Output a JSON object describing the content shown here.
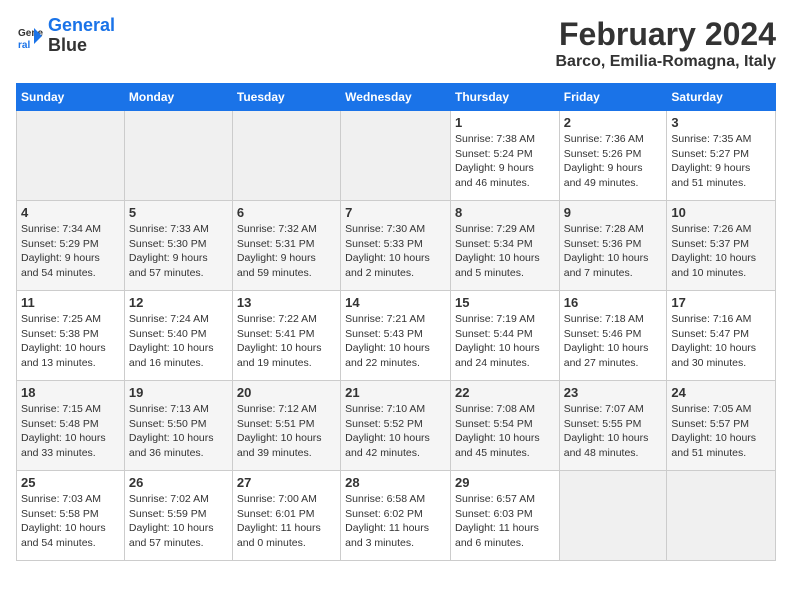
{
  "header": {
    "logo_line1": "General",
    "logo_line2": "Blue",
    "title": "February 2024",
    "subtitle": "Barco, Emilia-Romagna, Italy"
  },
  "days_of_week": [
    "Sunday",
    "Monday",
    "Tuesday",
    "Wednesday",
    "Thursday",
    "Friday",
    "Saturday"
  ],
  "weeks": [
    [
      {
        "day": "",
        "info": ""
      },
      {
        "day": "",
        "info": ""
      },
      {
        "day": "",
        "info": ""
      },
      {
        "day": "",
        "info": ""
      },
      {
        "day": "1",
        "info": "Sunrise: 7:38 AM\nSunset: 5:24 PM\nDaylight: 9 hours\nand 46 minutes."
      },
      {
        "day": "2",
        "info": "Sunrise: 7:36 AM\nSunset: 5:26 PM\nDaylight: 9 hours\nand 49 minutes."
      },
      {
        "day": "3",
        "info": "Sunrise: 7:35 AM\nSunset: 5:27 PM\nDaylight: 9 hours\nand 51 minutes."
      }
    ],
    [
      {
        "day": "4",
        "info": "Sunrise: 7:34 AM\nSunset: 5:29 PM\nDaylight: 9 hours\nand 54 minutes."
      },
      {
        "day": "5",
        "info": "Sunrise: 7:33 AM\nSunset: 5:30 PM\nDaylight: 9 hours\nand 57 minutes."
      },
      {
        "day": "6",
        "info": "Sunrise: 7:32 AM\nSunset: 5:31 PM\nDaylight: 9 hours\nand 59 minutes."
      },
      {
        "day": "7",
        "info": "Sunrise: 7:30 AM\nSunset: 5:33 PM\nDaylight: 10 hours\nand 2 minutes."
      },
      {
        "day": "8",
        "info": "Sunrise: 7:29 AM\nSunset: 5:34 PM\nDaylight: 10 hours\nand 5 minutes."
      },
      {
        "day": "9",
        "info": "Sunrise: 7:28 AM\nSunset: 5:36 PM\nDaylight: 10 hours\nand 7 minutes."
      },
      {
        "day": "10",
        "info": "Sunrise: 7:26 AM\nSunset: 5:37 PM\nDaylight: 10 hours\nand 10 minutes."
      }
    ],
    [
      {
        "day": "11",
        "info": "Sunrise: 7:25 AM\nSunset: 5:38 PM\nDaylight: 10 hours\nand 13 minutes."
      },
      {
        "day": "12",
        "info": "Sunrise: 7:24 AM\nSunset: 5:40 PM\nDaylight: 10 hours\nand 16 minutes."
      },
      {
        "day": "13",
        "info": "Sunrise: 7:22 AM\nSunset: 5:41 PM\nDaylight: 10 hours\nand 19 minutes."
      },
      {
        "day": "14",
        "info": "Sunrise: 7:21 AM\nSunset: 5:43 PM\nDaylight: 10 hours\nand 22 minutes."
      },
      {
        "day": "15",
        "info": "Sunrise: 7:19 AM\nSunset: 5:44 PM\nDaylight: 10 hours\nand 24 minutes."
      },
      {
        "day": "16",
        "info": "Sunrise: 7:18 AM\nSunset: 5:46 PM\nDaylight: 10 hours\nand 27 minutes."
      },
      {
        "day": "17",
        "info": "Sunrise: 7:16 AM\nSunset: 5:47 PM\nDaylight: 10 hours\nand 30 minutes."
      }
    ],
    [
      {
        "day": "18",
        "info": "Sunrise: 7:15 AM\nSunset: 5:48 PM\nDaylight: 10 hours\nand 33 minutes."
      },
      {
        "day": "19",
        "info": "Sunrise: 7:13 AM\nSunset: 5:50 PM\nDaylight: 10 hours\nand 36 minutes."
      },
      {
        "day": "20",
        "info": "Sunrise: 7:12 AM\nSunset: 5:51 PM\nDaylight: 10 hours\nand 39 minutes."
      },
      {
        "day": "21",
        "info": "Sunrise: 7:10 AM\nSunset: 5:52 PM\nDaylight: 10 hours\nand 42 minutes."
      },
      {
        "day": "22",
        "info": "Sunrise: 7:08 AM\nSunset: 5:54 PM\nDaylight: 10 hours\nand 45 minutes."
      },
      {
        "day": "23",
        "info": "Sunrise: 7:07 AM\nSunset: 5:55 PM\nDaylight: 10 hours\nand 48 minutes."
      },
      {
        "day": "24",
        "info": "Sunrise: 7:05 AM\nSunset: 5:57 PM\nDaylight: 10 hours\nand 51 minutes."
      }
    ],
    [
      {
        "day": "25",
        "info": "Sunrise: 7:03 AM\nSunset: 5:58 PM\nDaylight: 10 hours\nand 54 minutes."
      },
      {
        "day": "26",
        "info": "Sunrise: 7:02 AM\nSunset: 5:59 PM\nDaylight: 10 hours\nand 57 minutes."
      },
      {
        "day": "27",
        "info": "Sunrise: 7:00 AM\nSunset: 6:01 PM\nDaylight: 11 hours\nand 0 minutes."
      },
      {
        "day": "28",
        "info": "Sunrise: 6:58 AM\nSunset: 6:02 PM\nDaylight: 11 hours\nand 3 minutes."
      },
      {
        "day": "29",
        "info": "Sunrise: 6:57 AM\nSunset: 6:03 PM\nDaylight: 11 hours\nand 6 minutes."
      },
      {
        "day": "",
        "info": ""
      },
      {
        "day": "",
        "info": ""
      }
    ]
  ]
}
